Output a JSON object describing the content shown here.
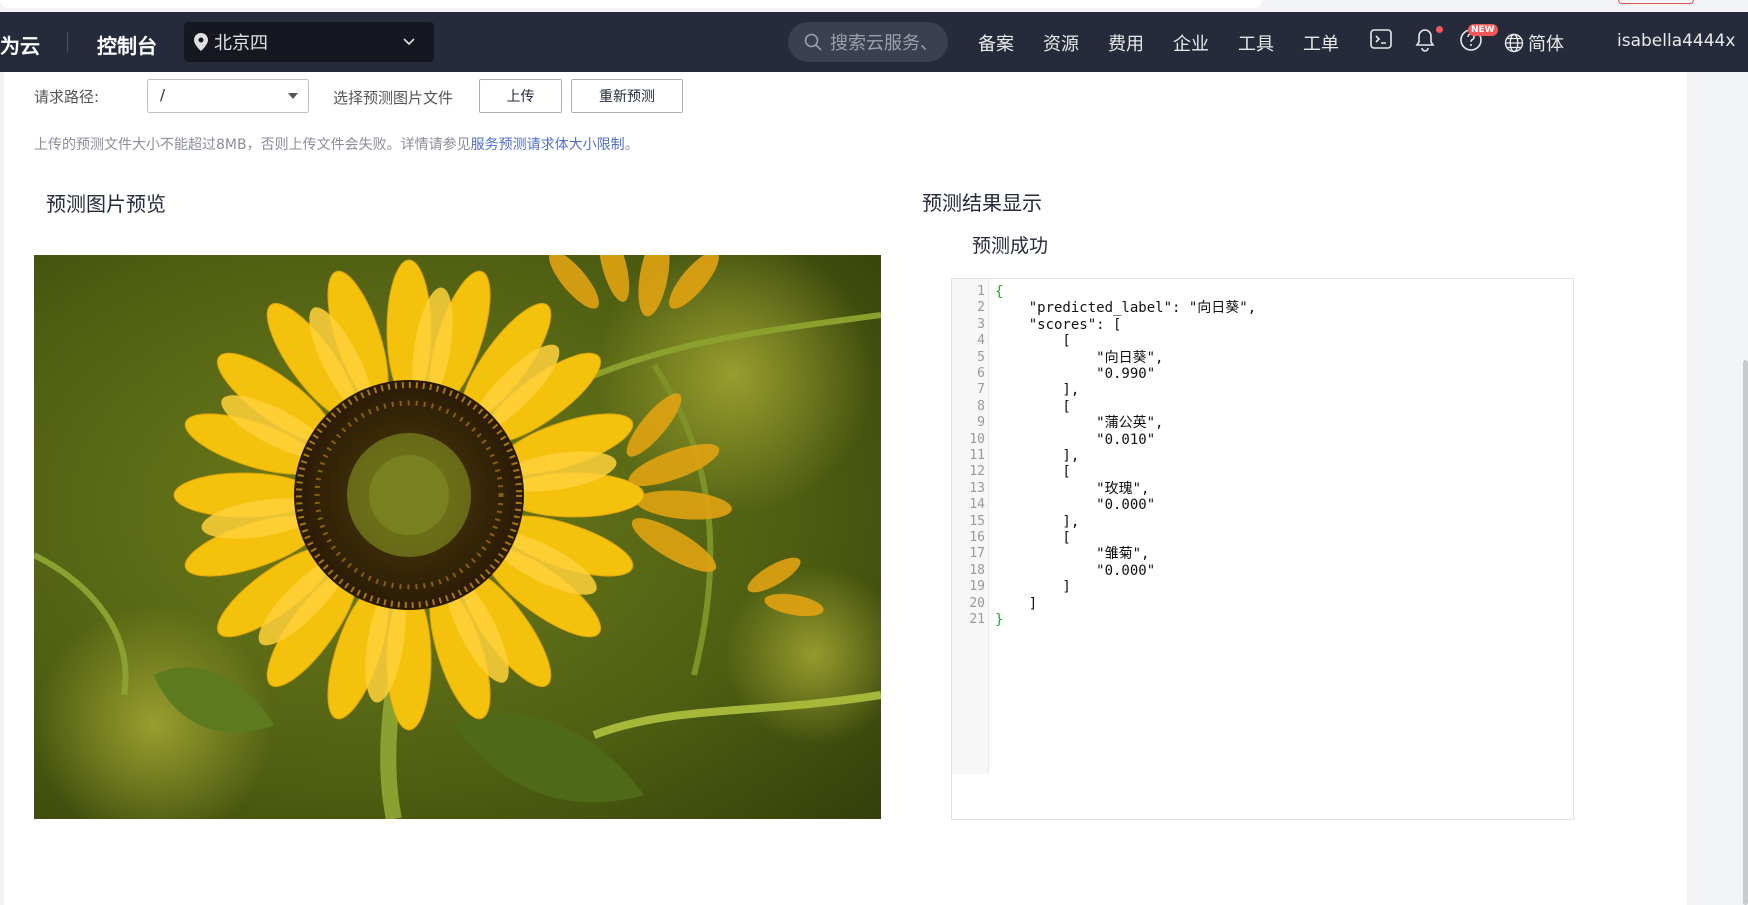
{
  "header": {
    "brand": "为云",
    "console": "控制台",
    "region": "北京四",
    "search_placeholder": "搜索云服务、",
    "nav": [
      "备案",
      "资源",
      "费用",
      "企业",
      "工具",
      "工单"
    ],
    "new_badge": "NEW",
    "language": "简体",
    "username": "isabella4444x"
  },
  "request": {
    "path_label": "请求路径:",
    "path_value": "/",
    "file_label": "选择预测图片文件",
    "upload_button": "上传",
    "repredict_button": "重新预测",
    "hint_text": "上传的预测文件大小不能超过8MB，否则上传文件会失败。详情请参见",
    "hint_link": "服务预测请求体大小限制",
    "hint_end": "。"
  },
  "preview": {
    "title": "预测图片预览"
  },
  "result": {
    "title": "预测结果显示",
    "status": "预测成功",
    "lines": [
      "{",
      "    \"predicted_label\": \"向日葵\",",
      "    \"scores\": [",
      "        [",
      "            \"向日葵\",",
      "            \"0.990\"",
      "        ],",
      "        [",
      "            \"蒲公英\",",
      "            \"0.010\"",
      "        ],",
      "        [",
      "            \"玫瑰\",",
      "            \"0.000\"",
      "        ],",
      "        [",
      "            \"雏菊\",",
      "            \"0.000\"",
      "        ]",
      "    ]",
      "}"
    ]
  },
  "colors": {
    "header_bg": "#252b3a",
    "link": "#526ecc",
    "brace": "#22a336",
    "badge": "#f2575b"
  }
}
